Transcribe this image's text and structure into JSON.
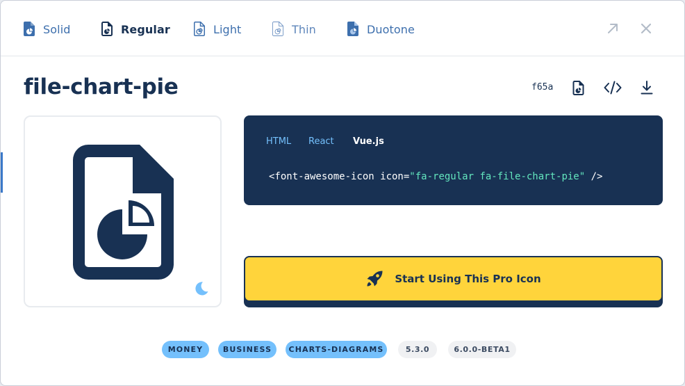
{
  "tabs": [
    {
      "label": "Solid",
      "icon": "file-chart-pie-solid-icon"
    },
    {
      "label": "Regular",
      "icon": "file-chart-pie-regular-icon"
    },
    {
      "label": "Light",
      "icon": "file-chart-pie-light-icon"
    },
    {
      "label": "Thin",
      "icon": "file-chart-pie-thin-icon"
    },
    {
      "label": "Duotone",
      "icon": "file-chart-pie-duotone-icon"
    }
  ],
  "active_tab": "Regular",
  "header_actions": {
    "open": "arrow-up-right-icon",
    "close": "close-icon"
  },
  "icon": {
    "name": "file-chart-pie",
    "unicode": "f65a"
  },
  "toolbar": {
    "glyph": "copy-glyph-icon",
    "code": "code-icon",
    "download": "download-icon"
  },
  "code": {
    "tabs": [
      "HTML",
      "React",
      "Vue.js"
    ],
    "active": "Vue.js",
    "snippet_start": "<font-awesome-icon icon=",
    "snippet_value": "\"fa-regular fa-file-chart-pie\"",
    "snippet_end": " />"
  },
  "cta": {
    "label": "Start Using This Pro Icon",
    "icon": "rocket-icon"
  },
  "preview_toggle": "moon-icon",
  "tags": {
    "categories": [
      "MONEY",
      "BUSINESS",
      "CHARTS-DIAGRAMS"
    ],
    "versions": [
      "5.3.0",
      "6.0.0-BETA1"
    ]
  },
  "colors": {
    "navy": "#183153",
    "accent_blue": "#74c0fc",
    "cta_yellow": "#ffd43b",
    "code_string": "#63e6be"
  }
}
